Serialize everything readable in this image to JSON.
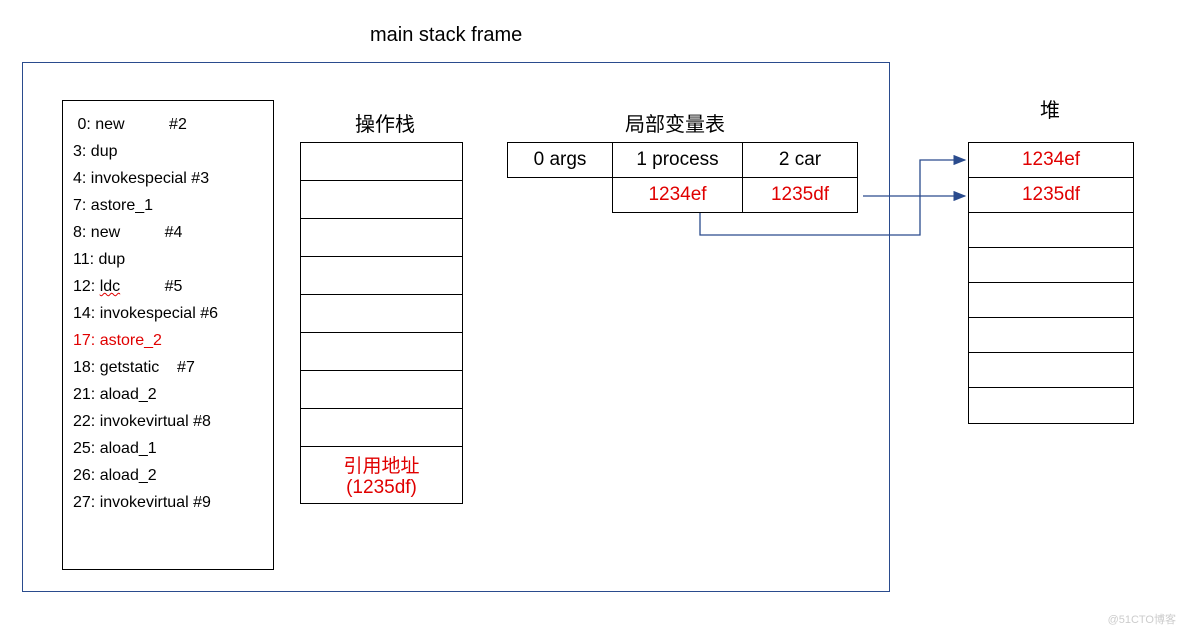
{
  "title": "main stack frame",
  "bytecode": {
    "lines": [
      " 0: new          #2",
      "3: dup",
      "4: invokespecial #3",
      "7: astore_1",
      "8: new          #4",
      "11: dup",
      "14: invokespecial #6",
      "18: getstatic    #7",
      "21: aload_2",
      "22: invokevirtual #8",
      "25: aload_1",
      "26: aload_2",
      "27: invokevirtual #9"
    ],
    "ldc_line_prefix": "12: ",
    "ldc_word": "ldc",
    "ldc_line_suffix": "          #5",
    "highlight_line": "17: astore_2"
  },
  "opstack": {
    "title": "操作栈",
    "last_line1": "引用地址",
    "last_line2": "(1235df)"
  },
  "lvt": {
    "title": "局部变量表",
    "headers": [
      "0 args",
      "1 process",
      "2 car"
    ],
    "values": [
      "",
      "1234ef",
      "1235df"
    ]
  },
  "heap": {
    "title": "堆",
    "rows": [
      "1234ef",
      "1235df",
      "",
      "",
      "",
      "",
      "",
      ""
    ]
  },
  "watermark": "@51CTO博客"
}
